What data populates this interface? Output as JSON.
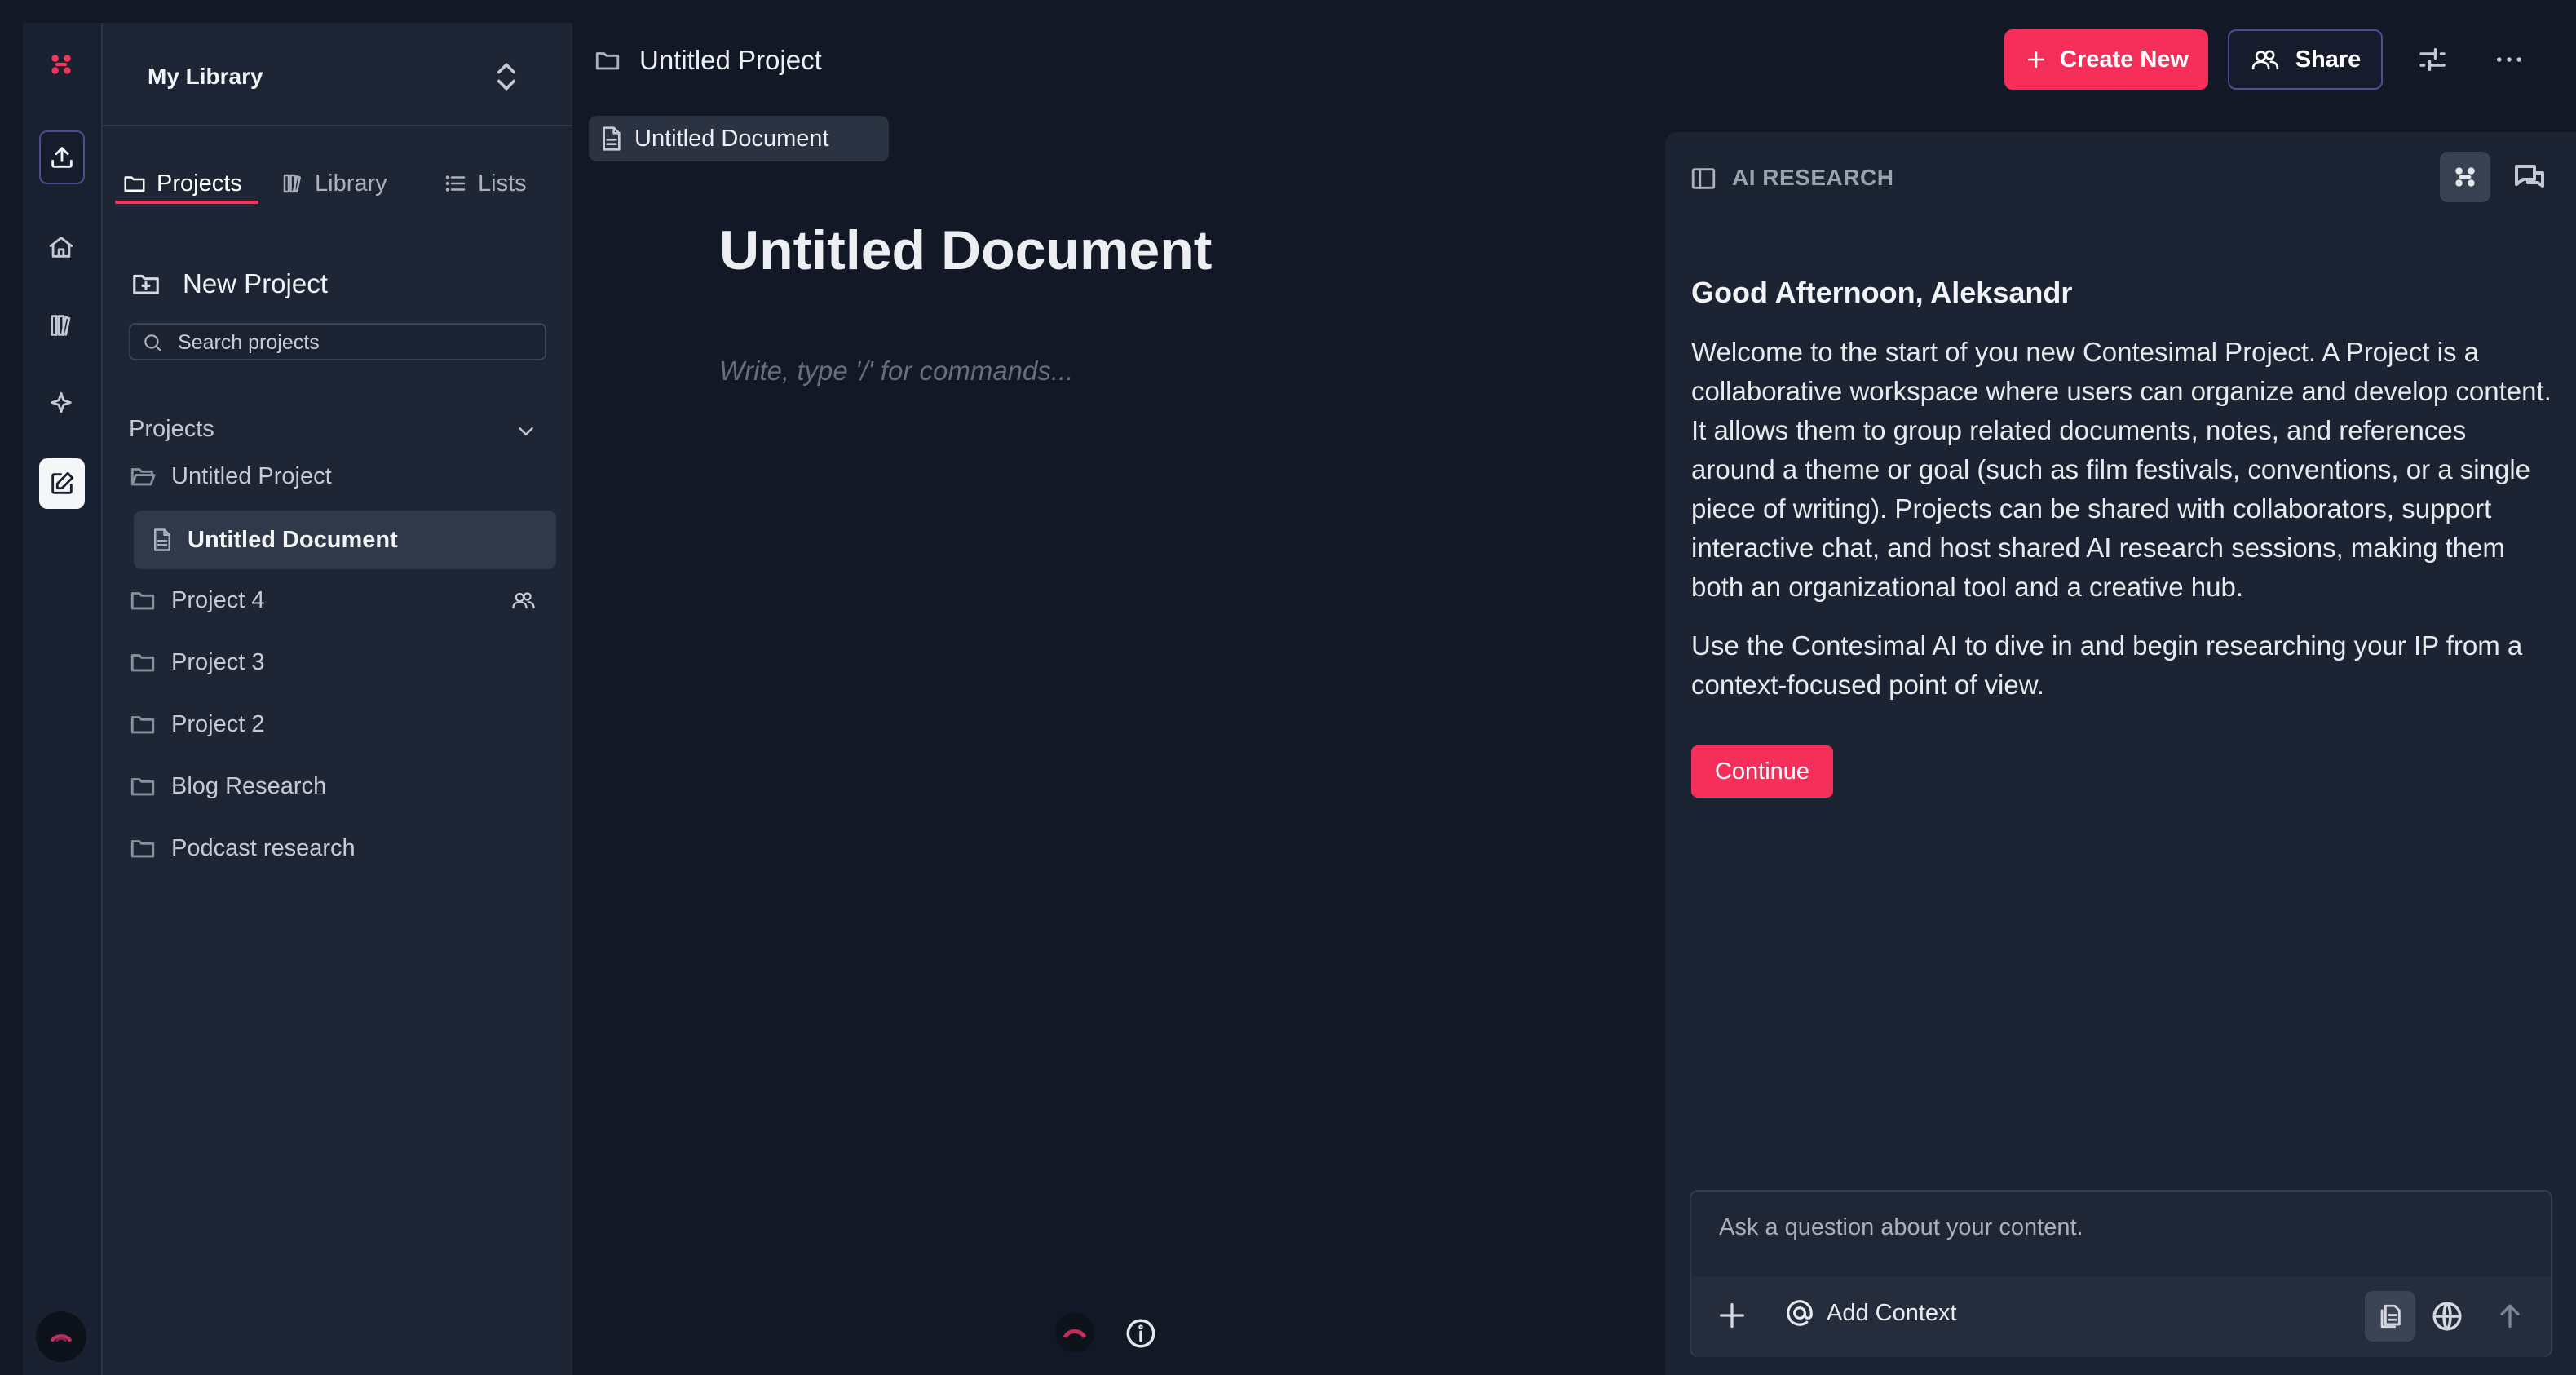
{
  "sidebar": {
    "library_title": "My Library",
    "tabs": [
      {
        "label": "Projects",
        "active": true
      },
      {
        "label": "Library",
        "active": false
      },
      {
        "label": "Lists",
        "active": false
      }
    ],
    "new_project_label": "New Project",
    "search_placeholder": "Search projects",
    "section_label": "Projects",
    "projects": [
      {
        "label": "Untitled Project",
        "icon": "folder-open-icon",
        "expanded": true
      },
      {
        "label": "Project 4",
        "icon": "folder-icon",
        "shared": true
      },
      {
        "label": "Project 3",
        "icon": "folder-icon"
      },
      {
        "label": "Project 2",
        "icon": "folder-icon"
      },
      {
        "label": "Blog Research",
        "icon": "folder-icon"
      },
      {
        "label": "Podcast research",
        "icon": "folder-icon"
      }
    ],
    "active_document": "Untitled Document"
  },
  "topbar": {
    "breadcrumb": "Untitled Project",
    "create_label": "Create New",
    "share_label": "Share"
  },
  "editor": {
    "tab_label": "Untitled Document",
    "title": "Untitled Document",
    "placeholder": "Write, type '/' for commands..."
  },
  "ai": {
    "header": "AI RESEARCH",
    "greeting": "Good Afternoon, Aleksandr",
    "paragraph1": "Welcome to the start of you new Contesimal Project. A Project is a collaborative workspace where users can organize and develop content. It allows them to group related documents, notes, and references around a theme or goal (such as film festivals, conventions, or a single piece of writing). Projects can be shared with collaborators, support interactive chat, and host shared AI research sessions, making them both an organizational tool and a creative hub.",
    "paragraph2": "Use the Contesimal AI to dive in and begin researching your IP from a context-focused point of view.",
    "continue_label": "Continue",
    "ask_placeholder": "Ask a question about your content.",
    "add_context_label": "Add Context"
  },
  "colors": {
    "accent": "#f52f5a",
    "background": "#121826",
    "panel": "#1e2636"
  }
}
